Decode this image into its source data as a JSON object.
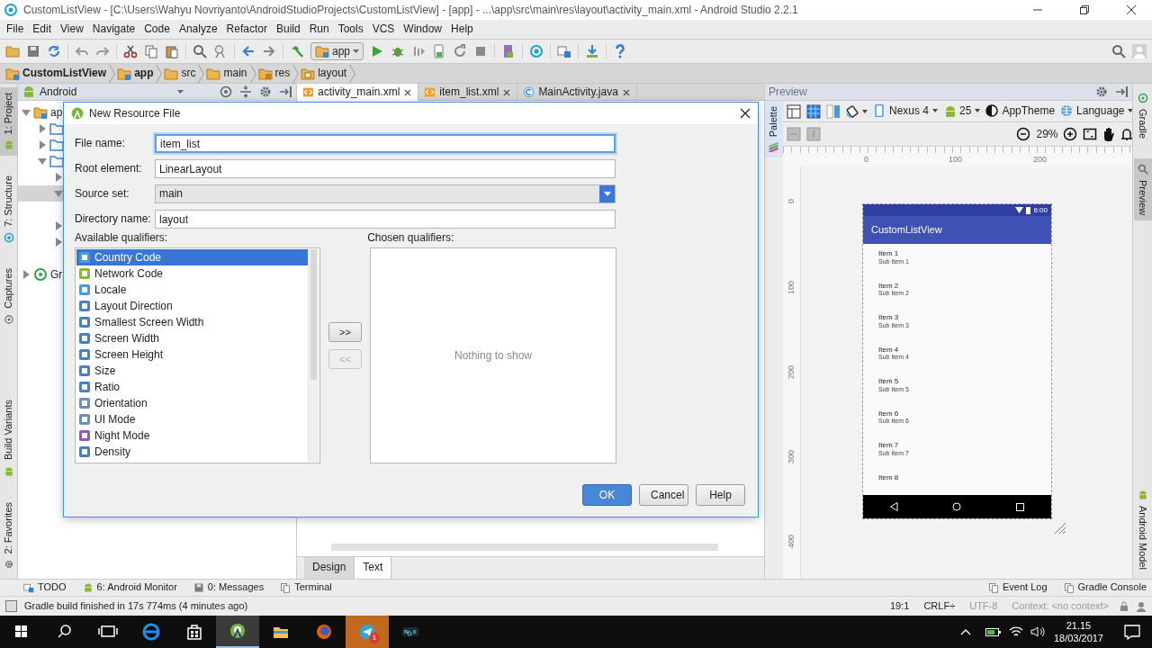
{
  "window": {
    "title": "CustomListView - [C:\\Users\\Wahyu Novriyanto\\AndroidStudioProjects\\CustomListView] - [app] - ...\\app\\src\\main\\res\\layout\\activity_main.xml - Android Studio 2.2.1"
  },
  "menu": [
    "File",
    "Edit",
    "View",
    "Navigate",
    "Code",
    "Analyze",
    "Refactor",
    "Build",
    "Run",
    "Tools",
    "VCS",
    "Window",
    "Help"
  ],
  "toolbar": {
    "run_config": "app"
  },
  "breadcrumbs": [
    {
      "label": "CustomListView",
      "kind": "module"
    },
    {
      "label": "app",
      "kind": "module"
    },
    {
      "label": "src",
      "kind": "folder"
    },
    {
      "label": "main",
      "kind": "folder"
    },
    {
      "label": "res",
      "kind": "res"
    },
    {
      "label": "layout",
      "kind": "layout"
    }
  ],
  "left_tool_tabs": [
    {
      "label": "1: Project",
      "selected": true,
      "kind": "top"
    },
    {
      "label": "7: Structure",
      "selected": false,
      "kind": "top"
    },
    {
      "label": "Captures",
      "selected": false,
      "kind": "top"
    },
    {
      "label": "Build Variants",
      "selected": false,
      "kind": "bottom"
    },
    {
      "label": "2: Favorites",
      "selected": false,
      "kind": "bottom"
    }
  ],
  "project_panel": {
    "view": "Android",
    "tree": [
      {
        "label": "ap",
        "kind": "module",
        "expanded": true,
        "selected": false,
        "children": [
          {
            "kind": "folder",
            "expanded": false,
            "selected": false
          },
          {
            "kind": "folder",
            "expanded": false,
            "selected": false
          },
          {
            "kind": "folder",
            "expanded": true,
            "selected": false,
            "children": [
              {
                "expanded": false,
                "selected": false
              },
              {
                "expanded": true,
                "selected": true,
                "children": [
                  {
                    "selected": false
                  }
                ]
              },
              {
                "expanded": false,
                "selected": false
              },
              {
                "expanded": false,
                "selected": false
              },
              {
                "selected": false
              }
            ]
          }
        ]
      },
      {
        "label": "Gr",
        "kind": "gradle",
        "expanded": false,
        "selected": false
      }
    ]
  },
  "editor_tabs": [
    {
      "label": "activity_main.xml",
      "kind": "xml",
      "selected": true
    },
    {
      "label": "item_list.xml",
      "kind": "xml",
      "selected": false
    },
    {
      "label": "MainActivity.java",
      "kind": "java",
      "selected": false
    }
  ],
  "editor_mode_tabs": [
    {
      "label": "Design",
      "selected": false
    },
    {
      "label": "Text",
      "selected": true
    }
  ],
  "preview": {
    "title": "Preview",
    "palette_tab": {
      "label": "Palette",
      "selected": true
    },
    "device": "Nexus 4",
    "api": "25",
    "theme": "AppTheme",
    "language": "Language",
    "zoom": "29%",
    "h_ruler": [
      "0",
      "100",
      "200"
    ],
    "v_ruler": [
      "0",
      "100",
      "200",
      "300",
      "400"
    ],
    "phone": {
      "time": "6:00",
      "app_title": "CustomListView",
      "items": [
        {
          "title": "Item 1",
          "subtitle": "Sub Item 1"
        },
        {
          "title": "Item 2",
          "subtitle": "Sub Item 2"
        },
        {
          "title": "Item 3",
          "subtitle": "Sub Item 3"
        },
        {
          "title": "Item 4",
          "subtitle": "Sub Item 4"
        },
        {
          "title": "Item 5",
          "subtitle": "Sub Item 5"
        },
        {
          "title": "Item 6",
          "subtitle": "Sub Item 6"
        },
        {
          "title": "Item 7",
          "subtitle": "Sub Item 7"
        },
        {
          "title": "Item 8"
        }
      ]
    }
  },
  "right_tool_tabs": [
    {
      "label": "Gradle",
      "selected": false,
      "kind": "top"
    },
    {
      "label": "Preview",
      "selected": true,
      "kind": "top"
    },
    {
      "label": "Android Model",
      "selected": false,
      "kind": "bottom"
    }
  ],
  "dialog": {
    "title": "New Resource File",
    "fields": [
      {
        "label": "File name:",
        "value": "item_list",
        "kind": "text",
        "focused": true
      },
      {
        "label": "Root element:",
        "value": "LinearLayout",
        "kind": "text",
        "focused": false
      },
      {
        "label": "Source set:",
        "value": "main",
        "kind": "select",
        "focused": false
      },
      {
        "label": "Directory name:",
        "value": "layout",
        "kind": "text",
        "focused": false
      }
    ],
    "available_label": "Available qualifiers:",
    "available": [
      {
        "label": "Country Code",
        "selected": true
      },
      {
        "label": "Network Code",
        "selected": false
      },
      {
        "label": "Locale",
        "selected": false
      },
      {
        "label": "Layout Direction",
        "selected": false
      },
      {
        "label": "Smallest Screen Width",
        "selected": false
      },
      {
        "label": "Screen Width",
        "selected": false
      },
      {
        "label": "Screen Height",
        "selected": false
      },
      {
        "label": "Size",
        "selected": false
      },
      {
        "label": "Ratio",
        "selected": false
      },
      {
        "label": "Orientation",
        "selected": false
      },
      {
        "label": "UI Mode",
        "selected": false
      },
      {
        "label": "Night Mode",
        "selected": false
      },
      {
        "label": "Density",
        "selected": false
      }
    ],
    "chosen_label": "Chosen qualifiers:",
    "chosen_empty": "Nothing to show",
    "move_buttons": [
      {
        "label": ">>",
        "disabled": false
      },
      {
        "label": "<<",
        "disabled": true
      }
    ],
    "buttons": [
      {
        "label": "OK",
        "default": true
      },
      {
        "label": "Cancel",
        "default": false
      },
      {
        "label": "Help",
        "default": false
      }
    ]
  },
  "tool_buttons": [
    {
      "label": "TODO",
      "kind": "left"
    },
    {
      "label": "6: Android Monitor",
      "kind": "left"
    },
    {
      "label": "0: Messages",
      "kind": "left"
    },
    {
      "label": "Terminal",
      "kind": "left"
    },
    {
      "label": "Event Log",
      "kind": "right"
    },
    {
      "label": "Gradle Console",
      "kind": "right"
    }
  ],
  "status_bar": {
    "message": "Gradle build finished in 17s 774ms (4 minutes ago)",
    "items": [
      {
        "label": "19:1",
        "disabled": false
      },
      {
        "label": "CRLF÷",
        "disabled": false
      },
      {
        "label": "UTF-8",
        "disabled": true
      },
      {
        "label": "Context: <no context>",
        "disabled": true
      }
    ]
  },
  "taskbar": {
    "apps": [
      {
        "kind": "edge",
        "selected": false,
        "attention": false
      },
      {
        "kind": "store",
        "selected": false,
        "attention": false
      },
      {
        "kind": "studio",
        "selected": true,
        "attention": false
      },
      {
        "kind": "explorer",
        "selected": false,
        "attention": false
      },
      {
        "kind": "firefox",
        "selected": false,
        "attention": false
      },
      {
        "kind": "telegram",
        "selected": false,
        "attention": true,
        "badge": "1"
      },
      {
        "kind": "nox",
        "selected": false,
        "attention": false
      }
    ],
    "time": "21.15",
    "date": "18/03/2017"
  }
}
